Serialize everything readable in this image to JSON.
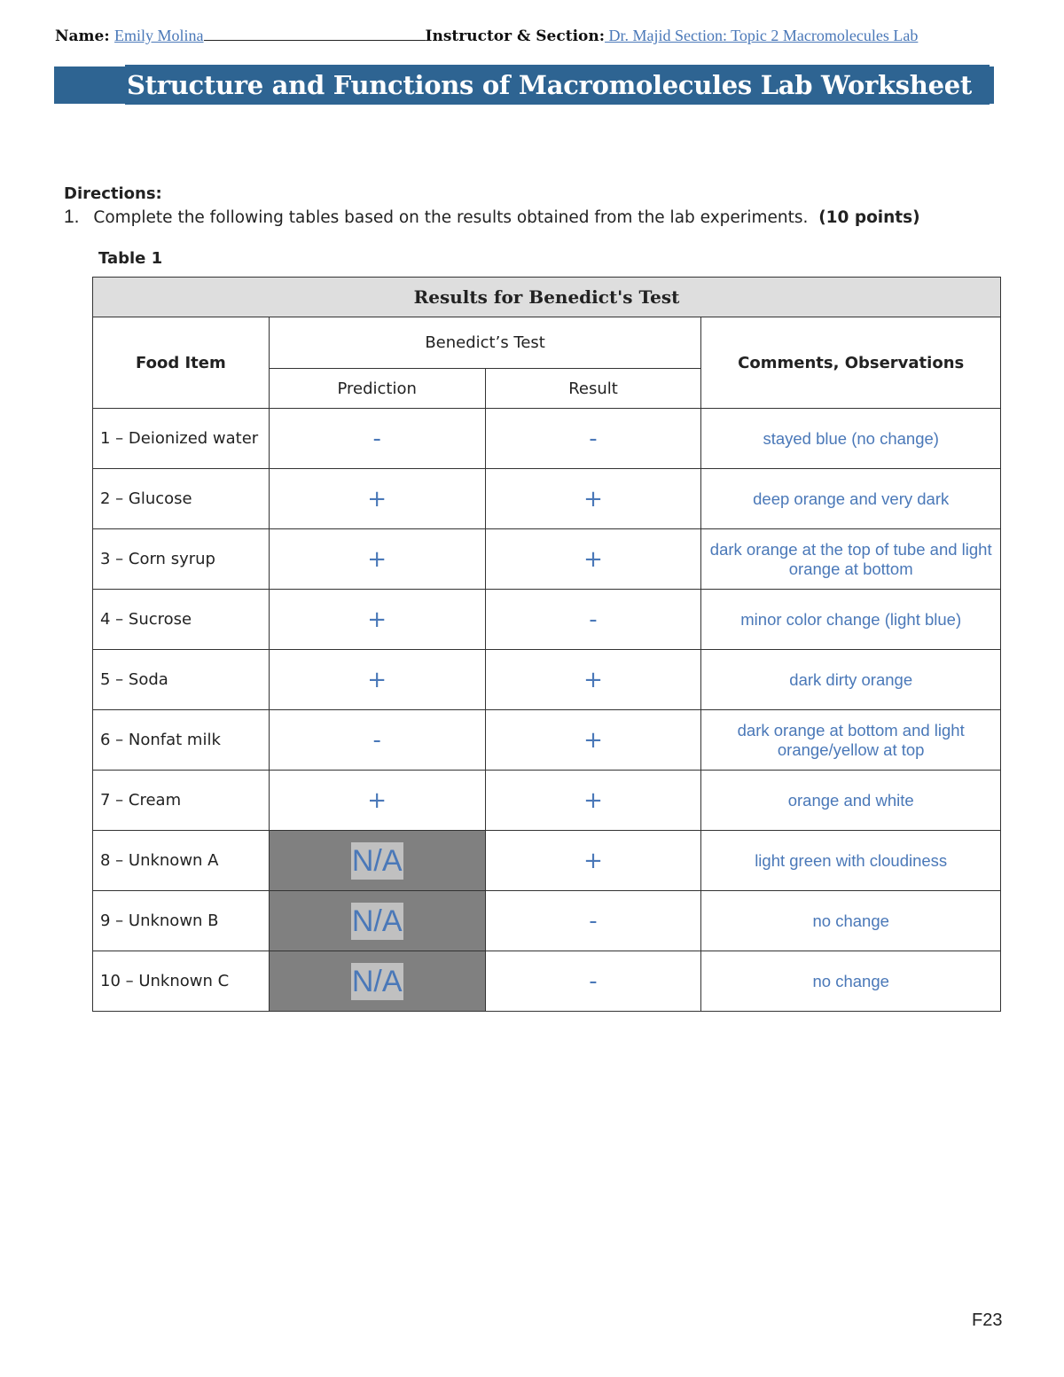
{
  "header": {
    "name_label": "Name:",
    "name_value": "Emily Molina",
    "instructor_label": "Instructor & Section:",
    "instructor_value": " Dr. Majid Section: Topic 2 Macromolecules Lab "
  },
  "title": "Structure and Functions of Macromolecules Lab Worksheet",
  "directions": {
    "heading": "Directions:",
    "step_number": "1.",
    "step_text": "Complete the following tables based on the results obtained from the lab experiments.",
    "step_points": "(10 points)"
  },
  "table": {
    "caption": "Table 1",
    "title": "Results for Benedict's Test",
    "headers": {
      "food_item": "Food Item",
      "test_group": "Benedict’s Test",
      "prediction": "Prediction",
      "result": "Result",
      "comments": "Comments, Observations"
    },
    "rows": [
      {
        "food": "1 – Deionized water",
        "prediction": "-",
        "result": "-",
        "comment": "stayed blue (no change)"
      },
      {
        "food": "2 – Glucose",
        "prediction": "+",
        "result": "+",
        "comment": "deep orange and very dark"
      },
      {
        "food": "3 – Corn syrup",
        "prediction": "+",
        "result": "+",
        "comment": "dark orange at the top of tube and light orange at bottom"
      },
      {
        "food": "4 – Sucrose",
        "prediction": "+",
        "result": "-",
        "comment": "minor color change (light blue)"
      },
      {
        "food": "5 – Soda",
        "prediction": "+",
        "result": "+",
        "comment": "dark dirty orange"
      },
      {
        "food": "6 – Nonfat milk",
        "prediction": "-",
        "result": "+",
        "comment": "dark orange at bottom and light orange/yellow at top"
      },
      {
        "food": "7 – Cream",
        "prediction": "+",
        "result": "+",
        "comment": "orange and white"
      },
      {
        "food": "8 – Unknown A",
        "prediction": "N/A",
        "result": "+",
        "comment": "light green with cloudiness"
      },
      {
        "food": "9 – Unknown B",
        "prediction": "N/A",
        "result": "-",
        "comment": "no change"
      },
      {
        "food": "10 – Unknown C",
        "prediction": "N/A",
        "result": "-",
        "comment": "no change"
      }
    ]
  },
  "footer": "F23",
  "colors": {
    "banner": "#2e6492",
    "answer_text": "#4a78b8",
    "title_row_bg": "#dedede",
    "na_cell_bg": "#808080",
    "na_highlight": "#c0c0c0"
  }
}
